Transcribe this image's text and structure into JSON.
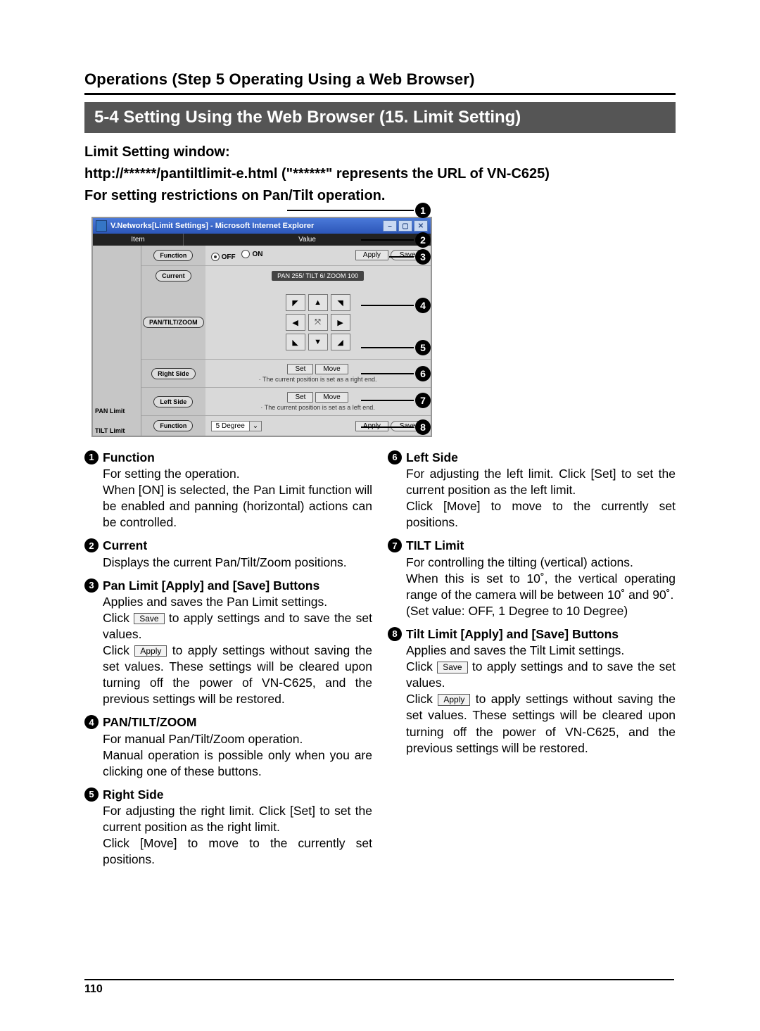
{
  "header": {
    "breadcrumb": "Operations (Step 5 Operating Using a Web Browser)",
    "section_title": "5-4 Setting Using the Web Browser (15. Limit Setting)"
  },
  "intro": {
    "line1": "Limit Setting window:",
    "line2": "http://******/pantiltlimit-e.html (\"******\" represents the URL of VN-C625)",
    "line3": "For setting restrictions on Pan/Tilt operation."
  },
  "shot": {
    "title": "V.Networks[Limit Settings] - Microsoft Internet Explorer",
    "header_item": "Item",
    "header_value": "Value",
    "labels": {
      "pan_limit": "PAN Limit",
      "tilt_limit": "TILT Limit",
      "function": "Function",
      "current": "Current",
      "ptz": "PAN/TILT/ZOOM",
      "right_side": "Right Side",
      "left_side": "Left Side"
    },
    "radio_off": "OFF",
    "radio_on": "ON",
    "btn_apply": "Apply",
    "btn_save": "Save",
    "current_value": "PAN 255/ TILT 6/ ZOOM 100",
    "btn_set": "Set",
    "btn_move": "Move",
    "note_right": "· The current position is set as a right end.",
    "note_left": "· The current position is set as a left end.",
    "select_value": "5 Degree"
  },
  "callouts": [
    "1",
    "2",
    "3",
    "4",
    "5",
    "6",
    "7",
    "8"
  ],
  "desc": {
    "left": [
      {
        "num": "1",
        "title": "Function",
        "body_parts": [
          "For setting the operation.",
          "When [ON] is selected, the Pan Limit function will be enabled and panning (horizontal) actions can be controlled."
        ]
      },
      {
        "num": "2",
        "title": "Current",
        "body_parts": [
          "Displays the current Pan/Tilt/Zoom positions."
        ]
      },
      {
        "num": "3",
        "title": "Pan Limit [Apply] and [Save] Buttons",
        "body_parts": [
          "Applies and saves the Pan Limit settings.",
          {
            "pre": "Click ",
            "btn": "Save",
            "post": " to apply settings and to save the set values."
          },
          {
            "pre": "Click ",
            "btn": "Apply",
            "post": " to apply settings without saving the set values. These settings will be cleared upon turning off the power of VN-C625, and the previous settings will be restored."
          }
        ]
      },
      {
        "num": "4",
        "title": "PAN/TILT/ZOOM",
        "body_parts": [
          "For manual Pan/Tilt/Zoom operation.",
          "Manual operation is possible only when you are clicking one of these buttons."
        ]
      },
      {
        "num": "5",
        "title": "Right Side",
        "body_parts": [
          "For adjusting the right limit. Click [Set] to set the current position as the right limit.",
          "Click [Move] to move to the currently set positions."
        ]
      }
    ],
    "right": [
      {
        "num": "6",
        "title": "Left Side",
        "body_parts": [
          "For adjusting the left limit. Click [Set] to set the current position as the left limit.",
          "Click [Move] to move to the currently set positions."
        ]
      },
      {
        "num": "7",
        "title": "TILT Limit",
        "body_parts": [
          "For controlling the tilting (vertical) actions.",
          "When this is set to 10˚, the vertical operating range of the camera will be between 10˚ and 90˚.",
          "(Set value: OFF, 1 Degree to 10 Degree)"
        ]
      },
      {
        "num": "8",
        "title": "Tilt Limit [Apply] and [Save] Buttons",
        "body_parts": [
          "Applies and saves the Tilt Limit settings.",
          {
            "pre": "Click ",
            "btn": "Save",
            "post": " to apply settings and to save the set values."
          },
          {
            "pre": "Click ",
            "btn": "Apply",
            "post": " to apply settings without saving the set values. These settings will be cleared upon turning off the power of VN-C625, and the previous settings will be restored."
          }
        ]
      }
    ]
  },
  "page_number": "110"
}
